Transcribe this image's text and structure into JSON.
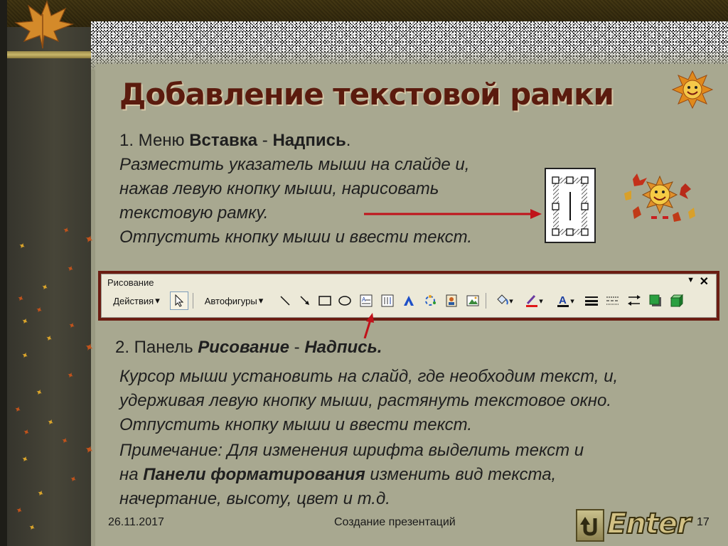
{
  "title": "Добавление текстовой рамки",
  "step1": {
    "prefix": "1. Меню ",
    "menu": "Вставка",
    "dash": " - ",
    "item": "Надпись",
    "end": ".",
    "lines": [
      "Разместить указатель мыши на слайде и,",
      "нажав левую кнопку мыши, нарисовать",
      "текстовую рамку.",
      "Отпустить кнопку мыши и ввести текст."
    ]
  },
  "toolbar": {
    "title": "Рисование",
    "dropdown": "▼",
    "close": "✕",
    "actions_label": "Действия",
    "autoshapes_label": "Автофигуры",
    "caret": "▾",
    "icons": [
      "cursor-arrow",
      "line",
      "arrow",
      "rectangle",
      "oval",
      "text-box",
      "vertical-text-box",
      "wordart",
      "diagram",
      "clipart",
      "picture",
      "fill-color",
      "line-color",
      "font-color",
      "line-style",
      "dash-style",
      "arrow-style",
      "shadow",
      "3d"
    ]
  },
  "step2": {
    "prefix": "2. Панель ",
    "panel": "Рисование",
    "dash": " - ",
    "item": "Надпись."
  },
  "body_lines": [
    "Курсор мыши установить на слайд, где необходим текст, и,",
    "удерживая левую кнопку мыши, растянуть текстовое окно.",
    "Отпустить кнопку мыши и ввести текст.",
    "Примечание: Для изменения шрифта выделить текст и"
  ],
  "note_line5": {
    "prefix": "на ",
    "bold": "Панели форматирования",
    "suffix": " изменить вид текста,"
  },
  "note_line6": "начертание, высоту, цвет и т.д.",
  "footer": {
    "date": "26.11.2017",
    "center": "Создание презентаций",
    "page": "17",
    "enter": "Enter"
  },
  "colors": {
    "title": "#5b1b0e",
    "arrow": "#c0121a",
    "toolbar_border": "#6b1d12",
    "slide_bg": "#a8a890"
  }
}
